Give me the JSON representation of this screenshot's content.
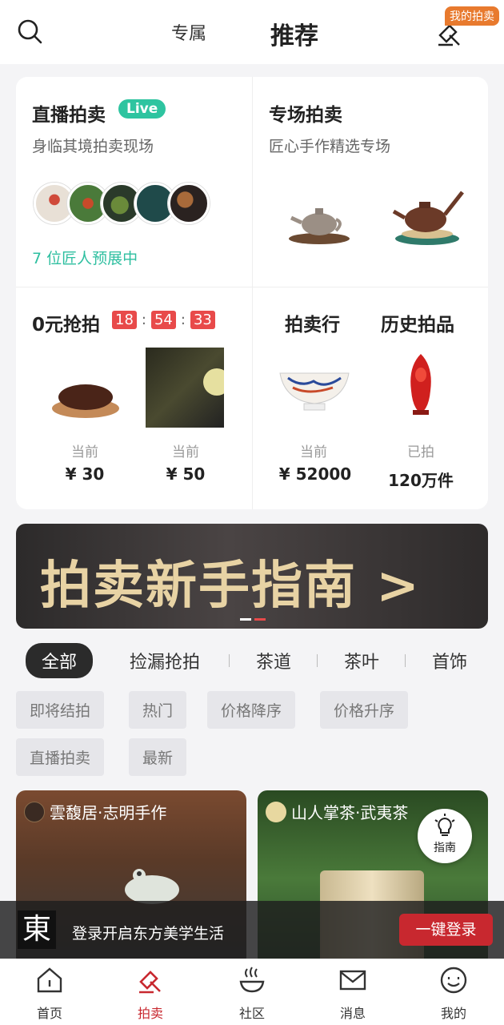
{
  "header": {
    "tab_exclusive": "专属",
    "tab_recommend": "推荐",
    "my_auction_badge": "我的拍卖",
    "icons": [
      "search-icon",
      "gavel-icon"
    ]
  },
  "live_auction": {
    "title": "直播拍卖",
    "live_badge": "Live",
    "subtitle": "身临其境拍卖现场",
    "preview_text": "7 位匠人预展中"
  },
  "special_auction": {
    "title": "专场拍卖",
    "subtitle": "匠心手作精选专场"
  },
  "zero_auction": {
    "title": "0元抢拍",
    "timer": [
      "18",
      "54",
      "33"
    ],
    "items": [
      {
        "label": "当前",
        "price": "¥ 30"
      },
      {
        "label": "当前",
        "price": "¥ 50"
      }
    ]
  },
  "auction_house": {
    "title": "拍卖行",
    "label": "当前",
    "price": "¥ 52000"
  },
  "history": {
    "title": "历史拍品",
    "label": "已拍",
    "count": "120万件"
  },
  "banner": {
    "text": "拍卖新手指南 >"
  },
  "categories": [
    "全部",
    "捡漏抢拍",
    "茶道",
    "茶叶",
    "首饰"
  ],
  "filters": [
    "即将结拍",
    "热门",
    "价格降序",
    "价格升序",
    "直播拍卖",
    "最新"
  ],
  "products": [
    {
      "shop": "雲馥居·志明手作"
    },
    {
      "shop": "山人掌茶·武夷茶"
    }
  ],
  "guide_label": "指南",
  "login_bar": {
    "logo": "東",
    "text": "登录开启东方美学生活",
    "button": "一键登录"
  },
  "nav": [
    {
      "label": "首页",
      "icon": "home-icon"
    },
    {
      "label": "拍卖",
      "icon": "gavel-icon"
    },
    {
      "label": "社区",
      "icon": "community-icon"
    },
    {
      "label": "消息",
      "icon": "message-icon"
    },
    {
      "label": "我的",
      "icon": "profile-icon"
    }
  ],
  "colors": {
    "accent_red": "#c8282f",
    "live_green": "#2ec4a0",
    "timer_red": "#e84a4a",
    "badge_orange": "#e87a2e"
  }
}
